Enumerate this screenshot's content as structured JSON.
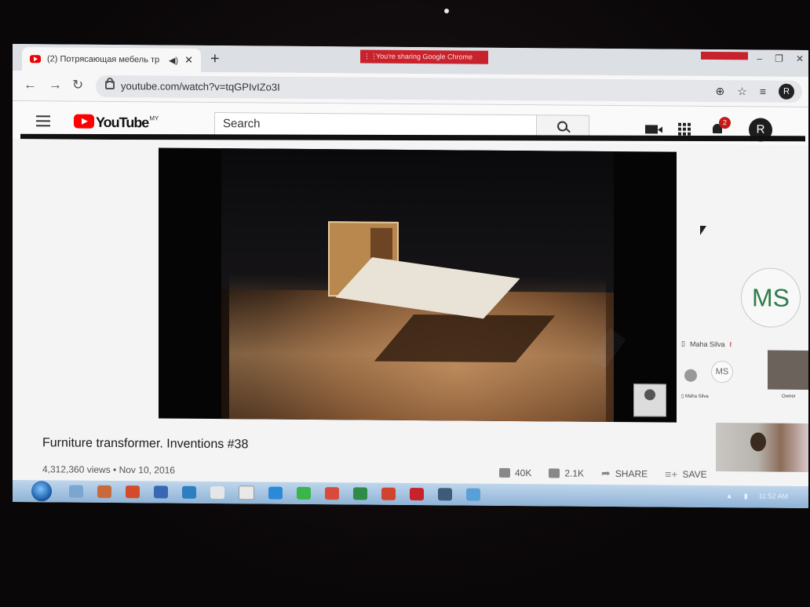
{
  "browser": {
    "tab_title": "(2) Потрясающая мебель тр",
    "new_tab": "+",
    "url": "youtube.com/watch?v=tqGPIvIZo3I",
    "sharing_banner": "You're sharing Google Chrome",
    "profile_initial": "R"
  },
  "youtube": {
    "logo_text": "YouTube",
    "region": "MY",
    "search_placeholder": "Search",
    "notification_count": "2",
    "avatar_initial": "R"
  },
  "video": {
    "title": "Furniture transformer. Inventions #38",
    "views_date": "4,312,360 views • Nov 10, 2016",
    "likes": "40K",
    "dislikes": "2.1K",
    "share_label": "SHARE",
    "save_label": "SAVE"
  },
  "meet": {
    "main_initials": "MS",
    "main_name": "Maha Silva",
    "mini_initials": "MS",
    "mini_name": "Maha Silva",
    "owner_label": "Owner"
  },
  "taskbar": {
    "clock": "11:52 AM"
  },
  "colors": {
    "youtube_red": "#ff0000",
    "share_banner": "#c8232c",
    "meet_initials": "#2f7d4a",
    "taskbar": "#9fbfe0"
  }
}
